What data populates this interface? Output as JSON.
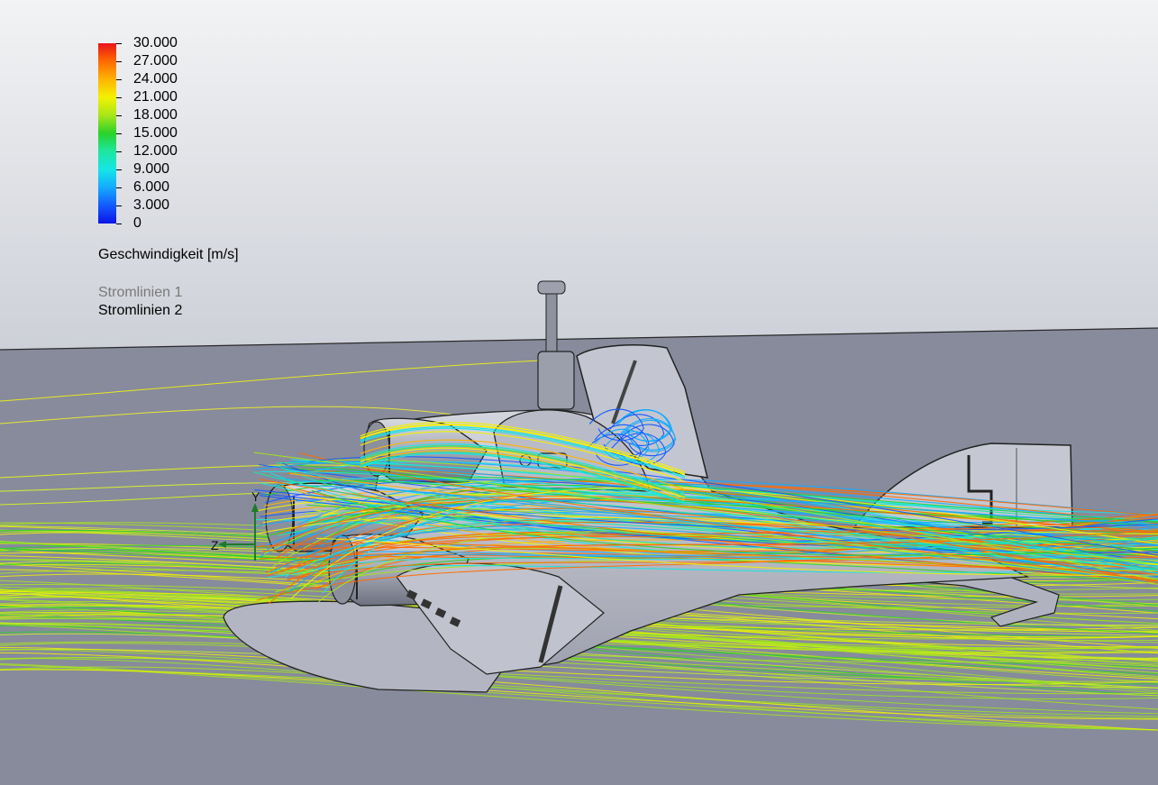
{
  "legend": {
    "ticks": [
      "30.000",
      "27.000",
      "24.000",
      "21.000",
      "18.000",
      "15.000",
      "12.000",
      "9.000",
      "6.000",
      "3.000",
      "0"
    ],
    "title": "Geschwindigkeit [m/s]",
    "min": 0,
    "max": 30,
    "colors": [
      "#0a14e6",
      "#145aff",
      "#14aaff",
      "#14e6e6",
      "#1ee6a0",
      "#28d228",
      "#a8e61a",
      "#f2f200",
      "#ffb400",
      "#ff6a00",
      "#e8141a"
    ]
  },
  "series": [
    {
      "label": "Stromlinien 1",
      "active": false
    },
    {
      "label": "Stromlinien 2",
      "active": true
    }
  ],
  "triad": {
    "y": "Y",
    "z": "Z"
  },
  "colors": {
    "sky_top": "#f0f1f2",
    "sky_bottom": "#c9ccd4",
    "floor": "#878b9c",
    "body": "#bfc2cc",
    "body_dark": "#9a9dab"
  }
}
